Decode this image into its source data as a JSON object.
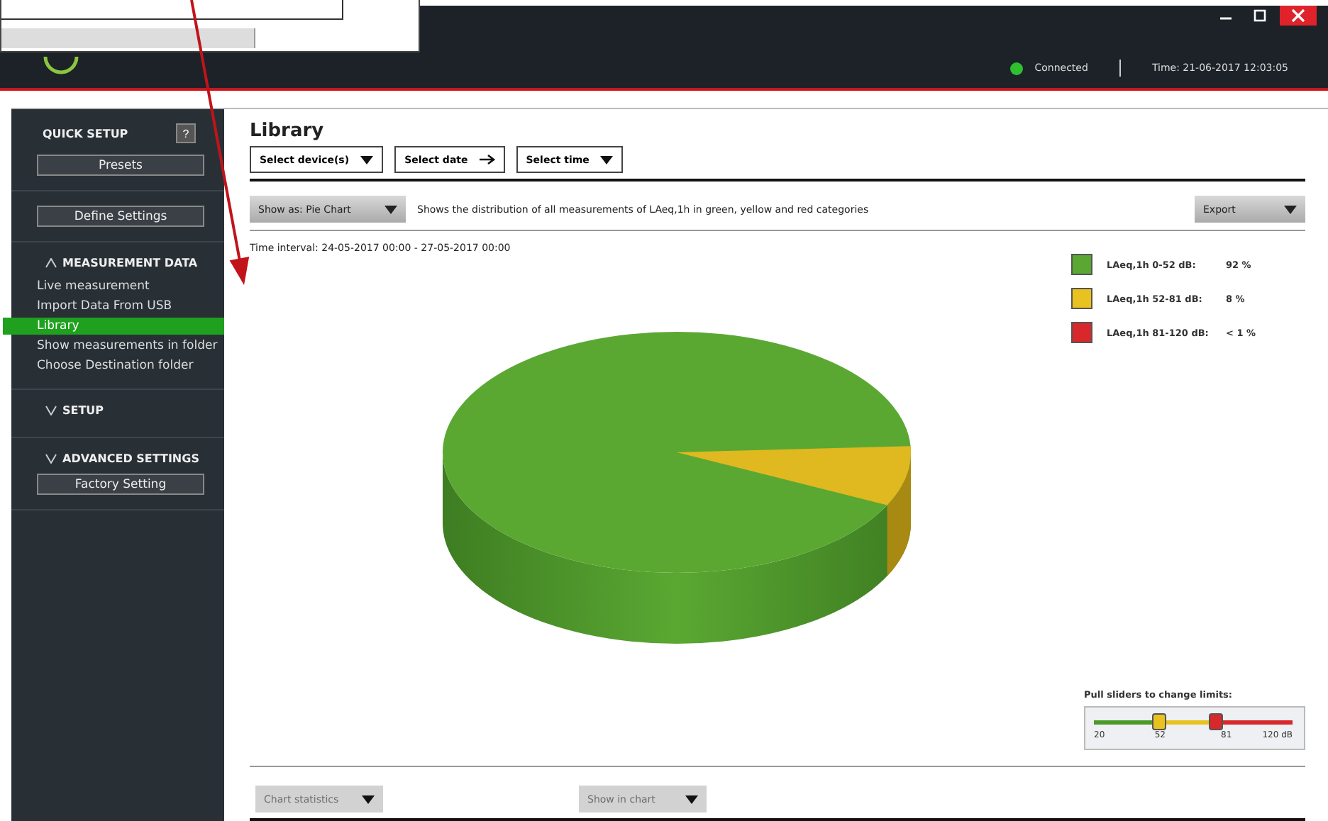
{
  "window": {
    "status": "Connected",
    "time": "Time: 21-06-2017 12:03:05"
  },
  "sidebar": {
    "quick_setup": {
      "title": "QUICK SETUP",
      "help": "?",
      "button": "Presets"
    },
    "define_button": "Define Settings",
    "sections": [
      {
        "title": "MEASUREMENT DATA",
        "expanded": true,
        "items": [
          {
            "label": "Live measurement",
            "selected": false
          },
          {
            "label": "Import Data From USB",
            "selected": false
          },
          {
            "label": "Library",
            "selected": true
          },
          {
            "label": "Show measurements in folder",
            "selected": false
          },
          {
            "label": "Choose Destination folder",
            "selected": false
          }
        ]
      },
      {
        "title": "SETUP",
        "expanded": false
      },
      {
        "title": "ADVANCED SETTINGS",
        "expanded": false,
        "button": "Factory Setting"
      }
    ]
  },
  "page": {
    "title": "Library",
    "filters": [
      {
        "label": "Select device(s)",
        "kind": "dropdown"
      },
      {
        "label": "Select date",
        "kind": "arrow"
      },
      {
        "label": "Select time",
        "kind": "dropdown"
      }
    ],
    "show_as": "Show as: Pie Chart",
    "description": "Shows the distribution of all measurements of LAeq,1h in green, yellow and red categories",
    "export": "Export",
    "time_interval": "Time interval: 24-05-2017 00:00 - 27-05-2017 00:00",
    "legend": [
      {
        "label": "LAeq,1h 0-52 dB:",
        "value": "92 %",
        "color": "#5aa832"
      },
      {
        "label": "LAeq,1h 52-81 dB:",
        "value": "8 %",
        "color": "#e8c21e"
      },
      {
        "label": "LAeq,1h 81-120 dB:",
        "value": "< 1 %",
        "color": "#d8282c"
      }
    ],
    "limits": {
      "caption": "Pull sliders to change limits:",
      "thumbs": [
        {
          "level": 0.32,
          "color": "#e8c21e"
        },
        {
          "level": 0.61,
          "color": "#d8282c"
        }
      ],
      "ticks": [
        "20",
        "52",
        "81",
        "120 dB"
      ]
    },
    "bottom_buttons": [
      {
        "label": "Chart statistics",
        "disabled": true
      },
      {
        "label": "Show in chart",
        "disabled": true
      }
    ]
  }
}
